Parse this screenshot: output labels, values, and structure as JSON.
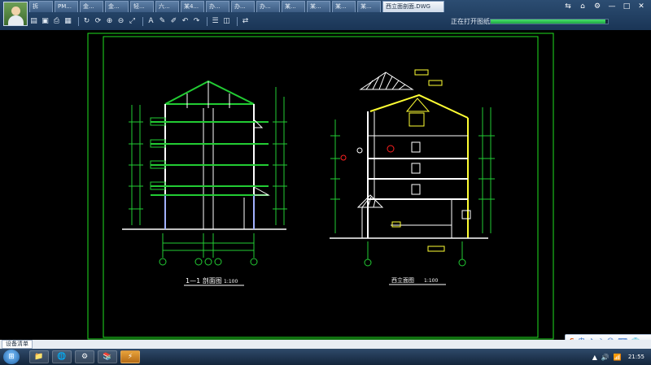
{
  "window": {
    "tabs": [
      {
        "label": "拆"
      },
      {
        "label": "PM..."
      },
      {
        "label": "金..."
      },
      {
        "label": "金..."
      },
      {
        "label": "轻..."
      },
      {
        "label": "六..."
      },
      {
        "label": "某4..."
      },
      {
        "label": "办..."
      },
      {
        "label": "办..."
      },
      {
        "label": "办..."
      },
      {
        "label": "某..."
      },
      {
        "label": "某..."
      },
      {
        "label": "某..."
      },
      {
        "label": "某..."
      },
      {
        "label": "西立面剖面.DWG",
        "active": true
      }
    ],
    "controls": [
      "⇆",
      "⌂",
      "⚙",
      "—",
      "□",
      "✕"
    ]
  },
  "toolbar": {
    "tools": [
      "open-icon",
      "save-icon",
      "print-icon",
      "grid-icon",
      "rotate-icon",
      "refresh-icon",
      "zoom-in-icon",
      "zoom-out-icon",
      "fit-icon",
      "text-icon",
      "pen-icon",
      "brush-icon",
      "undo-icon",
      "redo-icon",
      "layer-icon",
      "layers-icon",
      "measure-icon",
      "convert-icon"
    ],
    "status_text": "正在打开图纸",
    "progress": 0.98
  },
  "drawing": {
    "left_title": "1—1 剖面图",
    "left_scale": "1:100",
    "right_title": "西立面图",
    "right_scale": "1:100"
  },
  "statusbar": {
    "panel": "设备清单"
  },
  "taskbar": {
    "start": "⊞",
    "buttons": [
      "📁",
      "🌐",
      "⚙",
      "📚",
      "⚡"
    ],
    "tray": [
      "▲",
      "🔊",
      "📶"
    ],
    "clock": "21:55"
  },
  "ime": {
    "logo": "S",
    "mode": "中",
    "symbols": [
      "♪",
      "☽",
      "☺",
      "⌨",
      "👕"
    ]
  },
  "colors": {
    "frame": "#20e020",
    "wall": "#22cc33",
    "line_white": "#ffffff",
    "highlight": "#ffff33",
    "red": "#ff2020",
    "blue": "#4466ff"
  }
}
